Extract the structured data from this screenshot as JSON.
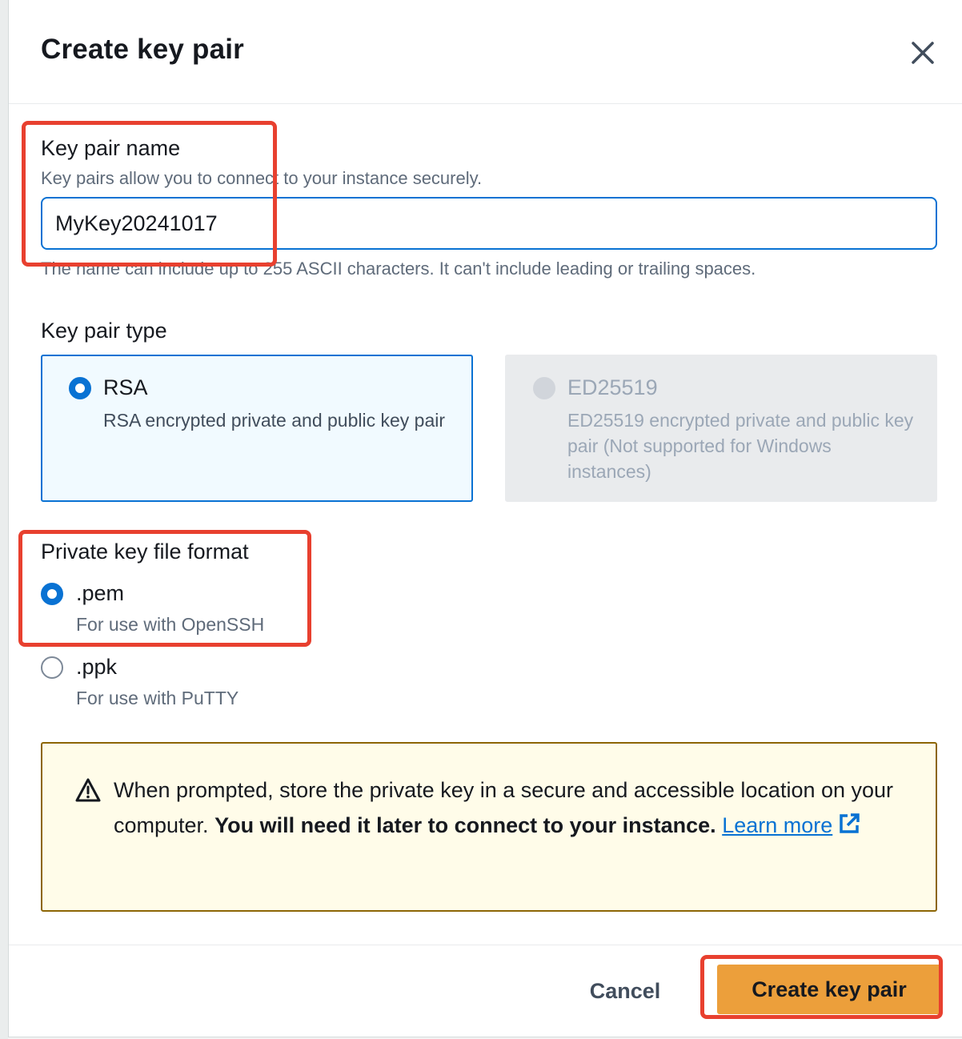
{
  "modal": {
    "title": "Create key pair",
    "close_icon": "close-icon"
  },
  "key_pair_name": {
    "label": "Key pair name",
    "description": "Key pairs allow you to connect to your instance securely.",
    "value": "MyKey20241017",
    "constraint": "The name can include up to 255 ASCII characters. It can't include leading or trailing spaces."
  },
  "key_pair_type": {
    "label": "Key pair type",
    "options": [
      {
        "title": "RSA",
        "description": "RSA encrypted private and public key pair",
        "selected": true,
        "disabled": false
      },
      {
        "title": "ED25519",
        "description": "ED25519 encrypted private and public key pair (Not supported for Windows instances)",
        "selected": false,
        "disabled": true
      }
    ]
  },
  "private_key_format": {
    "label": "Private key file format",
    "options": [
      {
        "title": ".pem",
        "description": "For use with OpenSSH",
        "selected": true
      },
      {
        "title": ".ppk",
        "description": "For use with PuTTY",
        "selected": false
      }
    ]
  },
  "alert": {
    "icon": "warning-icon",
    "text": "When prompted, store the private key in a secure and accessible location on your computer.",
    "bold_text": "You will need it later to connect to your instance.",
    "link_text": "Learn more",
    "link_icon": "external-link-icon"
  },
  "footer": {
    "cancel_label": "Cancel",
    "create_label": "Create key pair"
  },
  "colors": {
    "primary_blue": "#0972d3",
    "button_orange": "#ec9f3b",
    "highlight_red": "#e8402f",
    "warning_border": "#8d6605",
    "warning_bg": "#fffce9"
  }
}
